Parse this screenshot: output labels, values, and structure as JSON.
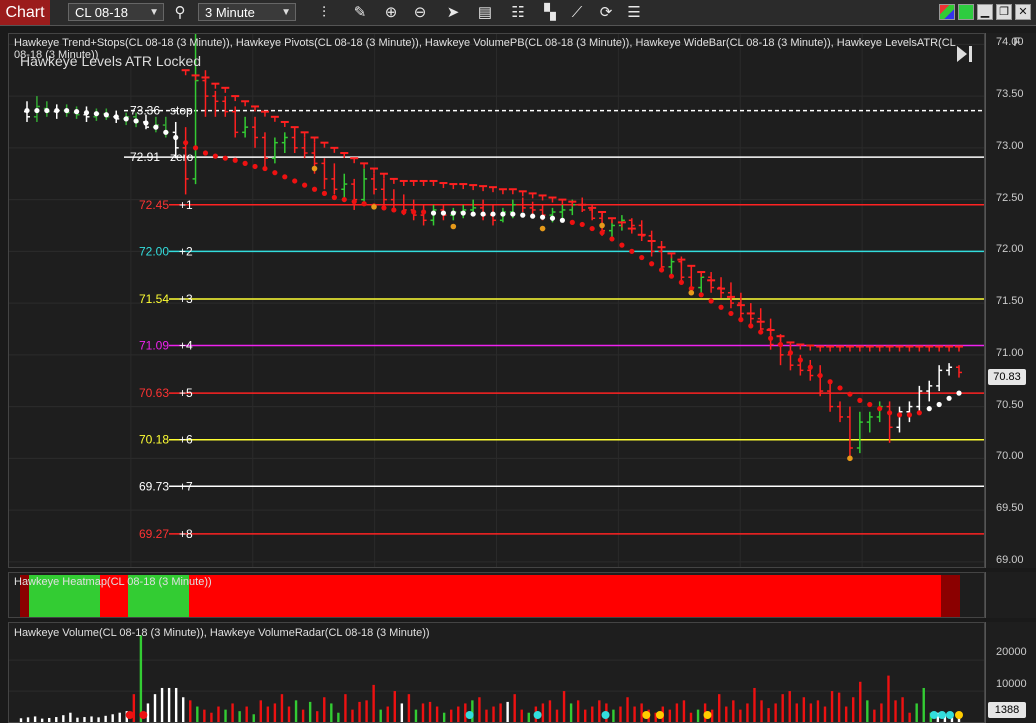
{
  "toolbar": {
    "chart_tab": "Chart",
    "instrument": "CL 08-18",
    "interval": "3 Minute",
    "icons": [
      "search-icon",
      "bar-type-icon",
      "draw-pencil-icon",
      "zoom-in-icon",
      "zoom-out-icon",
      "pointer-icon",
      "data-box-icon",
      "properties-icon",
      "templates-icon",
      "drawing-tools-icon",
      "reload-icon",
      "menu-list-icon"
    ],
    "window_buttons": [
      "tile-icon",
      "green-square-icon",
      "minimize-icon",
      "restore-icon",
      "close-icon"
    ]
  },
  "price_panel": {
    "indicators_label": "Hawkeye Trend+Stops(CL 08-18 (3 Minute)), Hawkeye Pivots(CL 08-18 (3 Minute)), Hawkeye VolumePB(CL 08-18 (3 Minute)), Hawkeye WideBar(CL 08-18 (3 Minute)), Hawkeye LevelsATR(CL 08-18 (3 Minute))",
    "overlay_title": "Hawkeye Levels ATR Locked",
    "f_button": "F",
    "last_price": "70.83"
  },
  "heatmap_panel": {
    "label": "Hawkeye Heatmap(CL 08-18 (3 Minute))",
    "segments": [
      {
        "color": "#8b0000",
        "frac": 0.01
      },
      {
        "color": "#33cc33",
        "frac": 0.075
      },
      {
        "color": "#ff0000",
        "frac": 0.03
      },
      {
        "color": "#33cc33",
        "frac": 0.065
      },
      {
        "color": "#ff0000",
        "frac": 0.8
      },
      {
        "color": "#8b0000",
        "frac": 0.02
      }
    ]
  },
  "volume_panel": {
    "label": "Hawkeye Volume(CL 08-18 (3 Minute)), Hawkeye VolumeRadar(CL 08-18 (3 Minute))",
    "last_volume": "1388",
    "axis_ticks": [
      "20000",
      "10000"
    ],
    "volumes": [
      1200,
      1500,
      1800,
      1100,
      1300,
      1600,
      2200,
      3000,
      1400,
      1600,
      1800,
      1500,
      2000,
      2500,
      3000,
      3500,
      9000,
      28000,
      6000,
      9000,
      11000,
      11000,
      11000,
      8000,
      7000,
      5000,
      4000,
      3000,
      5000,
      4000,
      6000,
      3500,
      5000,
      2500,
      7000,
      5000,
      6000,
      9000,
      5000,
      7000,
      4000,
      6500,
      3500,
      8000,
      6000,
      3000,
      9000,
      4000,
      6500,
      7000,
      12000,
      4000,
      5000,
      10000,
      6000,
      9000,
      4000,
      6000,
      6500,
      5000,
      3000,
      4000,
      5000,
      6000,
      7000,
      8000,
      4000,
      5000,
      6000,
      6500,
      9000,
      4000,
      3000,
      5000,
      6000,
      7000,
      4000,
      10000,
      6000,
      7000,
      4000,
      5000,
      7000,
      6000,
      4000,
      5000,
      8000,
      5000,
      6000,
      4000,
      3000,
      5000,
      4000,
      6000,
      7000,
      3000,
      4000,
      6000,
      4000,
      9000,
      5000,
      7000,
      4000,
      6000,
      11000,
      7000,
      4500,
      6000,
      9000,
      10000,
      6000,
      8000,
      6000,
      7000,
      5000,
      10000,
      9500,
      5000,
      8000,
      13000,
      7000,
      4000,
      6000,
      15000,
      7000,
      8000,
      3000,
      6000,
      11000,
      3000,
      3000,
      2500,
      2000,
      1388
    ],
    "volume_colors": [
      "w",
      "w",
      "w",
      "w",
      "w",
      "w",
      "w",
      "w",
      "w",
      "w",
      "w",
      "w",
      "w",
      "w",
      "w",
      "w",
      "r",
      "g",
      "w",
      "w",
      "w",
      "w",
      "w",
      "w",
      "r",
      "g",
      "r",
      "r",
      "r",
      "g",
      "r",
      "g",
      "r",
      "g",
      "r",
      "r",
      "r",
      "r",
      "r",
      "g",
      "r",
      "g",
      "r",
      "r",
      "g",
      "g",
      "r",
      "r",
      "r",
      "r",
      "r",
      "g",
      "r",
      "r",
      "w",
      "r",
      "g",
      "r",
      "r",
      "r",
      "g",
      "r",
      "r",
      "r",
      "g",
      "r",
      "r",
      "r",
      "r",
      "w",
      "r",
      "r",
      "g",
      "r",
      "r",
      "r",
      "r",
      "r",
      "g",
      "r",
      "r",
      "r",
      "r",
      "r",
      "g",
      "r",
      "r",
      "r",
      "r",
      "r",
      "r",
      "r",
      "r",
      "r",
      "r",
      "r",
      "g",
      "r",
      "r",
      "r",
      "r",
      "r",
      "r",
      "r",
      "r",
      "r",
      "r",
      "r",
      "r",
      "r",
      "r",
      "r",
      "r",
      "r",
      "r",
      "r",
      "r",
      "r",
      "r",
      "r",
      "g",
      "r",
      "r",
      "r",
      "r",
      "r",
      "r",
      "g",
      "g",
      "g",
      "w",
      "w",
      "w",
      "w"
    ]
  },
  "levels": [
    {
      "label": "73.36",
      "tag": "stop",
      "price": 73.36,
      "color": "#ffffff",
      "dashed": true
    },
    {
      "label": "72.91",
      "tag": "zero",
      "price": 72.91,
      "color": "#ffffff",
      "dashed": false
    },
    {
      "label": "72.45",
      "tag": "+1",
      "price": 72.45,
      "color": "#ff2222",
      "dashed": false
    },
    {
      "label": "72.00",
      "tag": "+2",
      "price": 72.0,
      "color": "#33dddd",
      "dashed": false
    },
    {
      "label": "71.54",
      "tag": "+3",
      "price": 71.54,
      "color": "#ffff33",
      "dashed": false
    },
    {
      "label": "71.09",
      "tag": "+4",
      "price": 71.09,
      "color": "#ee22ee",
      "dashed": false
    },
    {
      "label": "70.63",
      "tag": "+5",
      "price": 70.63,
      "color": "#ff2222",
      "dashed": false
    },
    {
      "label": "70.18",
      "tag": "+6",
      "price": 70.18,
      "color": "#ffff33",
      "dashed": false
    },
    {
      "label": "69.73",
      "tag": "+7",
      "price": 69.73,
      "color": "#ffffff",
      "dashed": false
    },
    {
      "label": "69.27",
      "tag": "+8",
      "price": 69.27,
      "color": "#ff2222",
      "dashed": false
    }
  ],
  "price_axis": [
    "74.00",
    "73.50",
    "73.00",
    "72.50",
    "72.00",
    "71.50",
    "71.00",
    "70.50",
    "70.00",
    "69.50",
    "69.00"
  ],
  "chart_data": {
    "type": "ohlc",
    "symbol": "CL 08-18",
    "interval": "3 Minute",
    "ylim": [
      68.95,
      74.1
    ],
    "bars": [
      [
        73.35,
        73.45,
        73.25,
        73.3
      ],
      [
        73.3,
        73.5,
        73.25,
        73.4
      ],
      [
        73.38,
        73.45,
        73.3,
        73.35
      ],
      [
        73.35,
        73.42,
        73.28,
        73.36
      ],
      [
        73.36,
        73.42,
        73.3,
        73.34
      ],
      [
        73.34,
        73.4,
        73.28,
        73.32
      ],
      [
        73.32,
        73.4,
        73.25,
        73.3
      ],
      [
        73.3,
        73.38,
        73.26,
        73.33
      ],
      [
        73.33,
        73.38,
        73.27,
        73.3
      ],
      [
        73.3,
        73.36,
        73.24,
        73.28
      ],
      [
        73.28,
        73.34,
        73.22,
        73.3
      ],
      [
        73.3,
        73.34,
        73.2,
        73.25
      ],
      [
        73.25,
        73.32,
        73.18,
        73.2
      ],
      [
        73.2,
        73.3,
        73.15,
        73.22
      ],
      [
        73.22,
        73.3,
        73.1,
        73.15
      ],
      [
        73.15,
        73.25,
        72.9,
        73.0
      ],
      [
        73.0,
        73.2,
        72.55,
        72.7
      ],
      [
        72.7,
        74.1,
        72.65,
        73.65
      ],
      [
        73.65,
        73.75,
        73.3,
        73.5
      ],
      [
        73.5,
        73.55,
        73.3,
        73.45
      ],
      [
        73.45,
        73.5,
        73.3,
        73.35
      ],
      [
        73.35,
        73.4,
        73.1,
        73.15
      ],
      [
        73.15,
        73.3,
        73.1,
        73.2
      ],
      [
        73.2,
        73.3,
        73.0,
        73.1
      ],
      [
        73.1,
        73.15,
        72.8,
        72.9
      ],
      [
        72.9,
        73.1,
        72.85,
        73.05
      ],
      [
        73.05,
        73.15,
        72.95,
        73.1
      ],
      [
        73.1,
        73.2,
        72.95,
        73.0
      ],
      [
        73.0,
        73.1,
        72.9,
        72.95
      ],
      [
        72.95,
        73.05,
        72.75,
        72.85
      ],
      [
        72.85,
        72.9,
        72.6,
        72.7
      ],
      [
        72.7,
        72.85,
        72.55,
        72.6
      ],
      [
        72.6,
        72.75,
        72.5,
        72.65
      ],
      [
        72.65,
        72.7,
        72.4,
        72.5
      ],
      [
        72.5,
        72.8,
        72.45,
        72.7
      ],
      [
        72.7,
        72.75,
        72.55,
        72.6
      ],
      [
        72.6,
        72.7,
        72.4,
        72.5
      ],
      [
        72.5,
        72.6,
        72.4,
        72.45
      ],
      [
        72.45,
        72.55,
        72.35,
        72.4
      ],
      [
        72.4,
        72.5,
        72.3,
        72.35
      ],
      [
        72.35,
        72.45,
        72.25,
        72.3
      ],
      [
        72.3,
        72.45,
        72.25,
        72.4
      ],
      [
        72.4,
        72.45,
        72.3,
        72.35
      ],
      [
        72.35,
        72.42,
        72.3,
        72.38
      ],
      [
        72.38,
        72.45,
        72.32,
        72.4
      ],
      [
        72.4,
        72.5,
        72.35,
        72.42
      ],
      [
        72.42,
        72.5,
        72.3,
        72.35
      ],
      [
        72.35,
        72.45,
        72.25,
        72.3
      ],
      [
        72.3,
        72.42,
        72.28,
        72.38
      ],
      [
        72.38,
        72.5,
        72.32,
        72.45
      ],
      [
        72.45,
        72.52,
        72.38,
        72.42
      ],
      [
        72.42,
        72.48,
        72.35,
        72.4
      ],
      [
        72.4,
        72.45,
        72.3,
        72.35
      ],
      [
        72.35,
        72.42,
        72.28,
        72.38
      ],
      [
        72.38,
        72.45,
        72.32,
        72.4
      ],
      [
        72.4,
        72.5,
        72.35,
        72.45
      ],
      [
        72.45,
        72.52,
        72.38,
        72.4
      ],
      [
        72.4,
        72.45,
        72.3,
        72.32
      ],
      [
        72.32,
        72.38,
        72.15,
        72.2
      ],
      [
        72.2,
        72.3,
        72.1,
        72.25
      ],
      [
        72.25,
        72.35,
        72.2,
        72.3
      ],
      [
        72.3,
        72.32,
        72.2,
        72.25
      ],
      [
        72.25,
        72.3,
        72.1,
        72.15
      ],
      [
        72.15,
        72.2,
        71.95,
        72.0
      ],
      [
        72.0,
        72.1,
        71.8,
        71.85
      ],
      [
        71.85,
        71.95,
        71.75,
        71.9
      ],
      [
        71.9,
        71.95,
        71.7,
        71.75
      ],
      [
        71.75,
        71.85,
        71.6,
        71.65
      ],
      [
        71.65,
        71.8,
        71.6,
        71.75
      ],
      [
        71.75,
        71.8,
        71.6,
        71.65
      ],
      [
        71.65,
        71.75,
        71.55,
        71.6
      ],
      [
        71.6,
        71.7,
        71.45,
        71.5
      ],
      [
        71.5,
        71.6,
        71.35,
        71.4
      ],
      [
        71.4,
        71.5,
        71.3,
        71.35
      ],
      [
        71.35,
        71.45,
        71.2,
        71.25
      ],
      [
        71.25,
        71.35,
        71.05,
        71.1
      ],
      [
        71.1,
        71.2,
        70.9,
        71.0
      ],
      [
        71.0,
        71.1,
        70.85,
        70.9
      ],
      [
        70.9,
        71.0,
        70.8,
        70.85
      ],
      [
        70.85,
        70.95,
        70.75,
        70.8
      ],
      [
        70.8,
        70.9,
        70.6,
        70.65
      ],
      [
        70.65,
        70.75,
        70.45,
        70.5
      ],
      [
        70.5,
        70.55,
        70.35,
        70.4
      ],
      [
        70.4,
        70.5,
        70.0,
        70.1
      ],
      [
        70.1,
        70.45,
        70.05,
        70.35
      ],
      [
        70.35,
        70.45,
        70.25,
        70.4
      ],
      [
        70.4,
        70.55,
        70.35,
        70.5
      ],
      [
        70.5,
        70.55,
        70.15,
        70.3
      ],
      [
        70.3,
        70.5,
        70.25,
        70.45
      ],
      [
        70.45,
        70.55,
        70.35,
        70.5
      ],
      [
        70.5,
        70.7,
        70.45,
        70.65
      ],
      [
        70.65,
        70.75,
        70.55,
        70.7
      ],
      [
        70.7,
        70.9,
        70.65,
        70.85
      ],
      [
        70.85,
        70.92,
        70.8,
        70.88
      ],
      [
        70.88,
        70.9,
        70.78,
        70.83
      ]
    ],
    "stops": [
      73.55,
      73.55,
      73.6,
      73.62,
      73.65,
      73.7,
      73.75,
      73.75,
      73.8,
      73.8,
      73.82,
      73.85,
      73.85,
      73.83,
      73.8,
      73.78,
      73.75,
      73.7,
      73.68,
      73.62,
      73.58,
      73.5,
      73.45,
      73.4,
      73.35,
      73.3,
      73.25,
      73.2,
      73.15,
      73.1,
      73.05,
      73.0,
      72.95,
      72.9,
      72.85,
      72.8,
      72.75,
      72.7,
      72.68,
      72.68,
      72.68,
      72.68,
      72.66,
      72.65,
      72.65,
      72.64,
      72.63,
      72.62,
      72.6,
      72.6,
      72.58,
      72.56,
      72.54,
      72.52,
      72.5,
      72.48,
      72.45,
      72.42,
      72.38,
      72.32,
      72.28,
      72.22,
      72.16,
      72.1,
      72.04,
      71.98,
      71.92,
      71.86,
      71.8,
      71.72,
      71.64,
      71.56,
      71.48,
      71.4,
      71.32,
      71.24,
      71.18,
      71.12,
      71.1,
      71.09,
      71.08,
      71.08,
      71.08,
      71.08,
      71.08,
      71.08,
      71.08,
      71.08,
      71.08,
      71.08,
      71.08,
      71.08,
      71.08,
      71.08,
      71.08
    ],
    "trend": [
      73.36,
      73.36,
      73.36,
      73.36,
      73.36,
      73.35,
      73.34,
      73.33,
      73.32,
      73.3,
      73.28,
      73.26,
      73.24,
      73.2,
      73.15,
      73.1,
      73.05,
      73.0,
      72.95,
      72.92,
      72.9,
      72.88,
      72.85,
      72.82,
      72.8,
      72.76,
      72.72,
      72.68,
      72.64,
      72.6,
      72.56,
      72.52,
      72.5,
      72.48,
      72.46,
      72.44,
      72.42,
      72.4,
      72.38,
      72.38,
      72.38,
      72.37,
      72.37,
      72.37,
      72.37,
      72.36,
      72.36,
      72.36,
      72.36,
      72.36,
      72.35,
      72.34,
      72.33,
      72.32,
      72.3,
      72.28,
      72.26,
      72.22,
      72.18,
      72.12,
      72.06,
      72.0,
      71.94,
      71.88,
      71.82,
      71.76,
      71.7,
      71.64,
      71.58,
      71.52,
      71.46,
      71.4,
      71.34,
      71.28,
      71.22,
      71.16,
      71.1,
      71.02,
      70.95,
      70.88,
      70.8,
      70.74,
      70.68,
      70.62,
      70.56,
      70.52,
      70.48,
      70.44,
      70.42,
      70.42,
      70.44,
      70.48,
      70.52,
      70.58,
      70.63
    ]
  }
}
